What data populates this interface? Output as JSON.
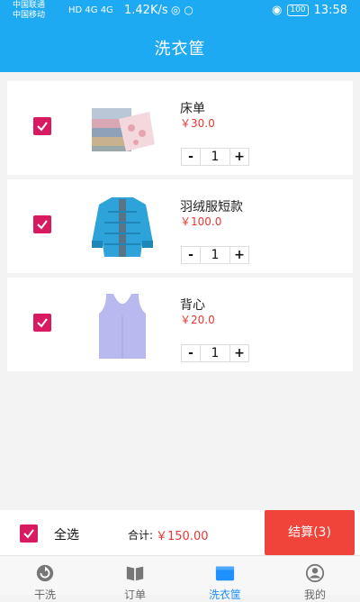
{
  "status_bar": {
    "carrier1": "中国联通",
    "carrier2": "中国移动",
    "net": "HD 4G 4G",
    "speed": "1.42K/s",
    "battery": "100",
    "time": "13:58"
  },
  "header": {
    "title": "洗衣筐"
  },
  "cart": {
    "items": [
      {
        "name": "床单",
        "price": "￥30.0",
        "qty": "1",
        "image": "bedsheet-image"
      },
      {
        "name": "羽绒服短款",
        "price": "￥100.0",
        "qty": "1",
        "image": "down-jacket-image"
      },
      {
        "name": "背心",
        "price": "￥20.0",
        "qty": "1",
        "image": "vest-image"
      }
    ],
    "minus_label": "-",
    "plus_label": "+"
  },
  "footer": {
    "select_all_label": "全选",
    "total_label": "合计:",
    "total_value": "￥150.00",
    "checkout_label": "结算(3)"
  },
  "tabbar": {
    "tabs": [
      {
        "label": "干洗",
        "icon": "refresh-icon"
      },
      {
        "label": "订单",
        "icon": "book-icon"
      },
      {
        "label": "洗衣筐",
        "icon": "basket-icon"
      },
      {
        "label": "我的",
        "icon": "user-icon"
      }
    ],
    "active_index": 2
  },
  "colors": {
    "header": "#1ea9f3",
    "checkbox": "#d81b60",
    "price": "#e53935",
    "checkout": "#f0443a",
    "active_tab": "#1e90ff"
  }
}
